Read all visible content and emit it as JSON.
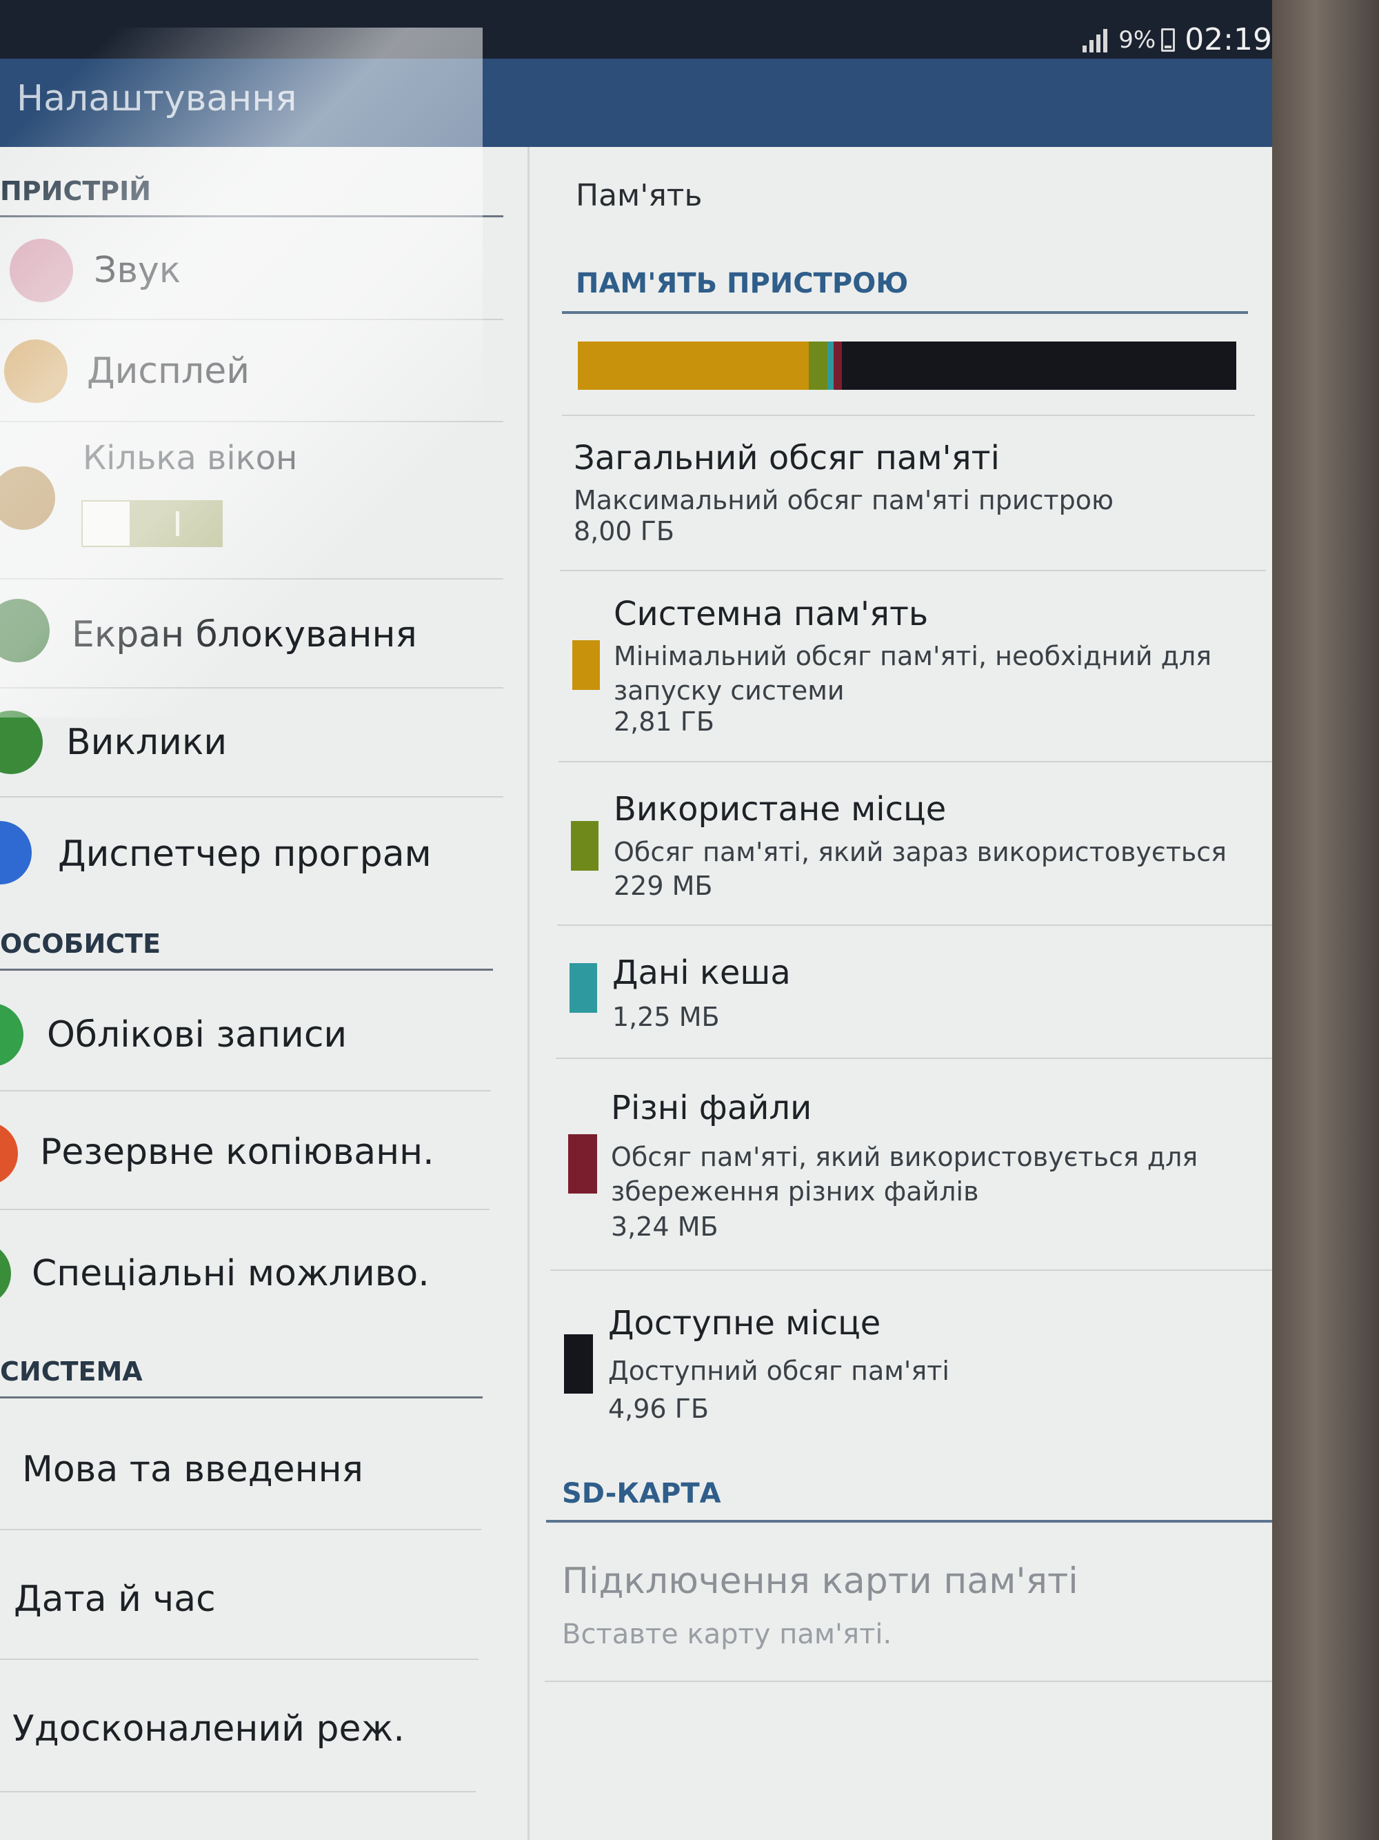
{
  "status_bar": {
    "battery": "9%",
    "time": "02:19"
  },
  "action_bar": {
    "title": "Налаштування"
  },
  "left_nav": {
    "sections": [
      {
        "header": "ПРИСТРІЙ"
      },
      {
        "header": "ОСОБИСТЕ"
      },
      {
        "header": "СИСТЕМА"
      }
    ],
    "items": [
      {
        "label": "Звук",
        "icon": "speaker-icon",
        "color": "#d8a8b6"
      },
      {
        "label": "Дисплей",
        "icon": "display-icon",
        "color": "#cfa05a"
      },
      {
        "label": "Кілька вікон",
        "icon": "multi-window-icon",
        "color": "#b08848",
        "toggle_on": true
      },
      {
        "label": "Екран блокування",
        "icon": "lock-screen-icon",
        "color": "#3f7a3e"
      },
      {
        "label": "Виклики",
        "icon": "phone-icon",
        "color": "#3a8a3a"
      },
      {
        "label": "Диспетчер програм",
        "icon": "apps-grid-icon",
        "color": "#2e6ad1"
      },
      {
        "label": "Облікові записи",
        "icon": "accounts-icon",
        "color": "#34a04a"
      },
      {
        "label": "Резервне копіюванн.",
        "icon": "backup-icon",
        "color": "#e0542c"
      },
      {
        "label": "Спеціальні можливо.",
        "icon": "accessibility-icon",
        "color": "#3a8e3a"
      },
      {
        "label": "Мова та введення"
      },
      {
        "label": "Дата й час"
      },
      {
        "label": "Удосконалений реж."
      }
    ]
  },
  "memory": {
    "page_title": "Пам'ять",
    "device_section": "ПАМ'ЯТЬ ПРИСТРОЮ",
    "usage_bar": [
      {
        "key": "system",
        "fraction": 0.351,
        "color": "#c8920c"
      },
      {
        "key": "used",
        "fraction": 0.028,
        "color": "#6f8a1a"
      },
      {
        "key": "cache",
        "fraction": 0.009,
        "color": "#2e9aa0"
      },
      {
        "key": "misc",
        "fraction": 0.013,
        "color": "#7a1e2e"
      },
      {
        "key": "available",
        "fraction": 0.599,
        "color": "#15161c"
      }
    ],
    "total": {
      "title": "Загальний обсяг пам'яті",
      "subtitle": "Максимальний обсяг пам'яті пристрою",
      "value": "8,00 ГБ"
    },
    "entries": [
      {
        "title": "Системна пам'ять",
        "subtitle": "Мінімальний обсяг пам'яті, необхідний для запуску системи",
        "value": "2,81 ГБ",
        "color": "#c8920c"
      },
      {
        "title": "Використане місце",
        "subtitle": "Обсяг пам'яті, який зараз використовується",
        "value": "229 МБ",
        "color": "#6f8a1a"
      },
      {
        "title": "Дані кеша",
        "subtitle": "",
        "value": "1,25 МБ",
        "color": "#2e9aa0"
      },
      {
        "title": "Різні файли",
        "subtitle": "Обсяг пам'яті, який використовується для збереження різних файлів",
        "value": "3,24 МБ",
        "color": "#7a1e2e"
      },
      {
        "title": "Доступне місце",
        "subtitle": "Доступний обсяг пам'яті",
        "value": "4,96 ГБ",
        "color": "#15161c"
      }
    ],
    "sd_section": "SD-КАРТА",
    "sd_card": {
      "title": "Підключення карти пам'яті",
      "subtitle": "Вставте карту пам'яті."
    }
  }
}
